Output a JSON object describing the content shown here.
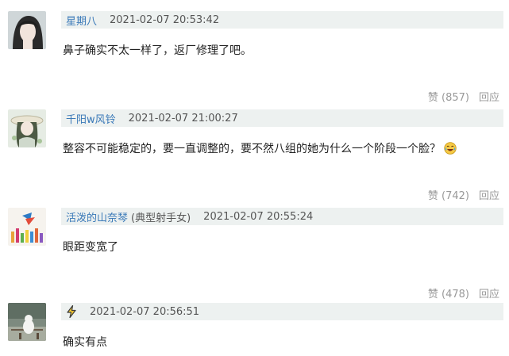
{
  "comments": [
    {
      "username": "星期八",
      "timestamp": "2021-02-07 20:53:42",
      "text": "鼻子确实不太一样了，返厂修理了吧。",
      "like_label": "赞 (857)",
      "reply_label": "回应"
    },
    {
      "username": "千阳w风铃",
      "timestamp": "2021-02-07 21:00:27",
      "text": "整容不可能稳定的，要一直调整的，要不然八组的她为什么一个阶段一个脸？",
      "like_label": "赞 (742)",
      "reply_label": "回应"
    },
    {
      "username": "活泼的山奈琴",
      "badge": "(典型射手女)",
      "timestamp": "2021-02-07 20:55:24",
      "text": "眼距变宽了",
      "like_label": "赞 (478)",
      "reply_label": "回应"
    },
    {
      "timestamp": "2021-02-07 20:56:51",
      "text": "确实有点"
    }
  ],
  "colors": {
    "header_bg": "#edf1f0",
    "username": "#3a79b8",
    "meta": "#999999"
  }
}
